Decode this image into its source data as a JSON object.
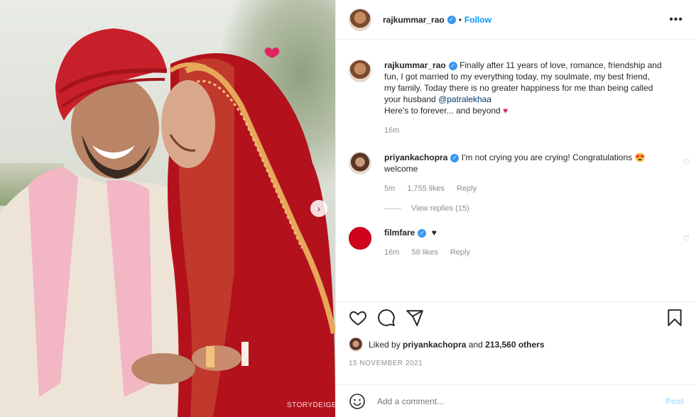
{
  "post": {
    "username": "rajkummar_rao",
    "follow_label": "Follow",
    "more_label": "•••",
    "caption": "Finally after 11 years of love, romance, friendship and fun, I got married to my everything today, my soulmate, my best friend, my family. Today there is no greater happiness for me than being called your husband",
    "mention": "@patralekhaa",
    "caption_end": "Here's to forever... and beyond",
    "caption_time": "16m",
    "watermark": "STORYDEIGE"
  },
  "comments": [
    {
      "username": "priyankachopra",
      "text": "I'm not crying you are crying! Congratulations 😍 welcome",
      "time": "5m",
      "likes": "1,755 likes",
      "reply": "Reply",
      "view_replies": "View replies (15)"
    },
    {
      "username": "filmfare",
      "text": "♥",
      "time": "16m",
      "likes": "58 likes",
      "reply": "Reply"
    }
  ],
  "likes": {
    "prefix": "Liked by",
    "user": "priyankachopra",
    "middle": "and",
    "count": "213,560 others"
  },
  "date": "15 NOVEMBER 2021",
  "add_comment": {
    "placeholder": "Add a comment...",
    "post_label": "Post"
  },
  "icons": [
    "heart-icon",
    "comment-icon",
    "share-icon",
    "bookmark-icon",
    "emoji-icon",
    "verified-icon",
    "chevron-right-icon"
  ],
  "colors": {
    "accent": "#0095f6",
    "verified": "#3897f0",
    "heart": "#e0245e"
  }
}
